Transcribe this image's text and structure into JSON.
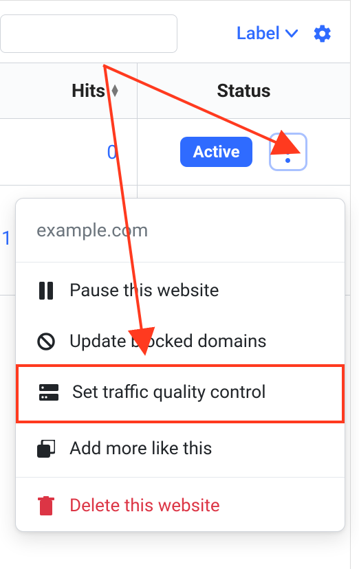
{
  "toolbar": {
    "label_button": "Label"
  },
  "table": {
    "headers": {
      "hits": "Hits",
      "status": "Status"
    },
    "rows": [
      {
        "hits": "0",
        "status": "Active"
      }
    ]
  },
  "partial_next_hits": "1",
  "dropdown": {
    "domain": "example.com",
    "items": {
      "pause": "Pause this website",
      "blocked": "Update blocked domains",
      "traffic": "Set traffic quality control",
      "addmore": "Add more like this",
      "delete": "Delete this website"
    }
  }
}
